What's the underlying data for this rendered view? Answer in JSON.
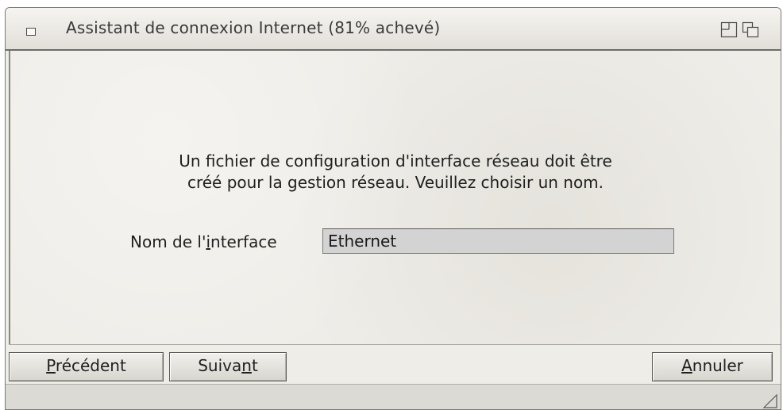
{
  "window": {
    "title": "Assistant de connexion Internet (81% achevé)",
    "progress_percent": 81
  },
  "message": {
    "line1": "Un fichier de configuration d'interface réseau doit être",
    "line2": "créé pour la gestion réseau. Veuillez choisir un nom."
  },
  "interface_field": {
    "label_before": "Nom de l'",
    "label_mnemonic": "i",
    "label_after": "nterface",
    "value": "Ethernet"
  },
  "buttons": {
    "previous": {
      "mnemonic": "P",
      "rest": "récédent"
    },
    "next": {
      "before": "Suiva",
      "mnemonic": "n",
      "after": "t"
    },
    "cancel": {
      "mnemonic": "A",
      "rest": "nnuler"
    }
  },
  "icons": {
    "window_menu": "window-menu-icon",
    "maximize": "maximize-icon",
    "shade": "shade-icon",
    "resize_grip": "resize-grip-icon"
  },
  "colors": {
    "window_bg": "#efede8",
    "input_bg": "#d3d3d3",
    "text": "#202020"
  }
}
